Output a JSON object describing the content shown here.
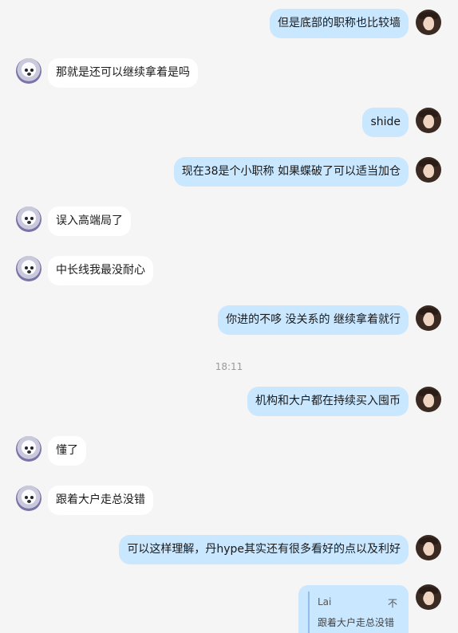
{
  "messages": [
    {
      "side": "out",
      "text": "但是底部的职称也比较墙"
    },
    {
      "side": "in",
      "text": "那就是还可以继续拿着是吗"
    },
    {
      "side": "out",
      "text": "shide"
    },
    {
      "side": "out",
      "text": "现在38是个小职称  如果蝶破了可以适当加仓"
    },
    {
      "side": "in",
      "text": "误入高端局了"
    },
    {
      "side": "in",
      "text": "中长线我最没耐心"
    },
    {
      "side": "out",
      "text": "你进的不哆  没关系的  继续拿着就行"
    },
    {
      "side": "out",
      "text": "机构和大户都在持续买入囤币"
    },
    {
      "side": "in",
      "text": "懂了"
    },
    {
      "side": "in",
      "text": "跟着大户走总没错"
    },
    {
      "side": "out",
      "text": "可以这样理解，丹hype其实还有很多看好的点以及利好"
    }
  ],
  "timestamp": "18:11",
  "quote": {
    "author": "Lai",
    "right_text": "不",
    "text": "跟着大户走总没错"
  },
  "colors": {
    "background": "#f5f5f5",
    "incoming_bubble": "#ffffff",
    "outgoing_bubble": "#c9e7ff"
  }
}
